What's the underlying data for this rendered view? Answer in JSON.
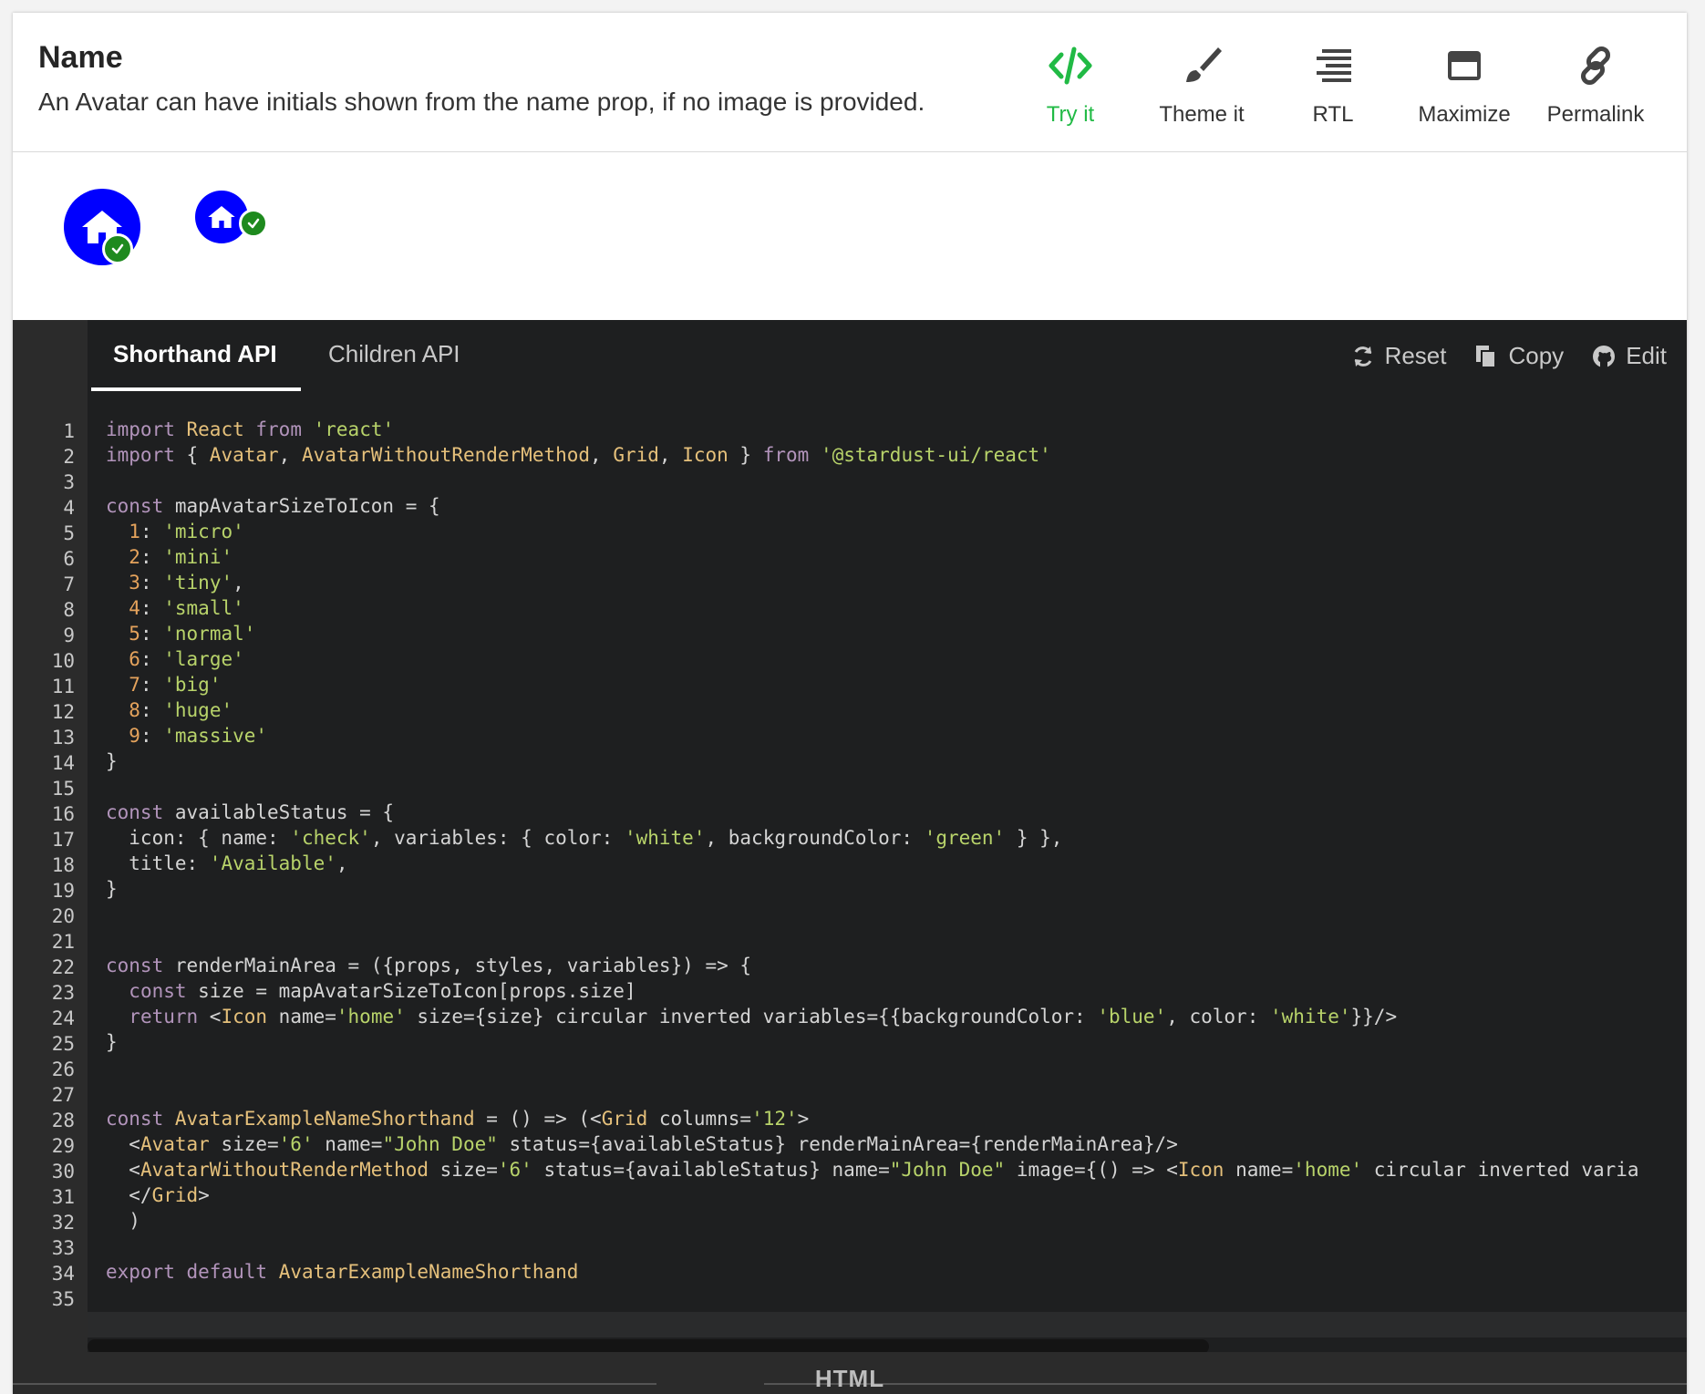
{
  "header": {
    "title": "Name",
    "description": "An Avatar can have initials shown from the name prop, if no image is provided."
  },
  "toolbar": {
    "try_it": "Try it",
    "theme_it": "Theme it",
    "rtl": "RTL",
    "maximize": "Maximize",
    "permalink": "Permalink",
    "active_color": "#21ba45"
  },
  "preview": {
    "avatar_bg": "#0000ff",
    "status_bg": "#1e8a1e",
    "icon": "home-icon",
    "status_icon": "check-icon"
  },
  "code_tabs": {
    "shorthand": "Shorthand API",
    "children": "Children API"
  },
  "code_actions": {
    "reset": "Reset",
    "copy": "Copy",
    "edit": "Edit"
  },
  "editor": {
    "highlighted_line": 30,
    "line_numbers": [
      "1",
      "2",
      "3",
      "4",
      "5",
      "6",
      "7",
      "8",
      "9",
      "10",
      "11",
      "12",
      "13",
      "14",
      "15",
      "16",
      "17",
      "18",
      "19",
      "20",
      "21",
      "22",
      "23",
      "24",
      "25",
      "26",
      "27",
      "28",
      "29",
      "30",
      "31",
      "32",
      "33",
      "34",
      "35"
    ],
    "lines": [
      "import React from 'react'",
      "import { Avatar, AvatarWithoutRenderMethod, Grid, Icon } from '@stardust-ui/react'",
      "",
      "const mapAvatarSizeToIcon = {",
      "  1: 'micro'",
      "  2: 'mini'",
      "  3: 'tiny',",
      "  4: 'small'",
      "  5: 'normal'",
      "  6: 'large'",
      "  7: 'big'",
      "  8: 'huge'",
      "  9: 'massive'",
      "}",
      "",
      "const availableStatus = {",
      "  icon: { name: 'check', variables: { color: 'white', backgroundColor: 'green' } },",
      "  title: 'Available',",
      "}",
      "",
      "",
      "const renderMainArea = ({props, styles, variables}) => {",
      "  const size = mapAvatarSizeToIcon[props.size]",
      "  return <Icon name='home' size={size} circular inverted variables={{backgroundColor: 'blue', color: 'white'}}/>",
      "}",
      "",
      "",
      "const AvatarExampleNameShorthand = () => (<Grid columns='12'>",
      "  <Avatar size='6' name=\"John Doe\" status={availableStatus} renderMainArea={renderMainArea}/>",
      "  <AvatarWithoutRenderMethod size='6' status={availableStatus} name=\"John Doe\" image={() => <Icon name='home' circular inverted varia",
      "  </Grid>",
      "  )",
      "",
      "export default AvatarExampleNameShorthand",
      ""
    ]
  },
  "footer": {
    "html_label": "HTML"
  }
}
